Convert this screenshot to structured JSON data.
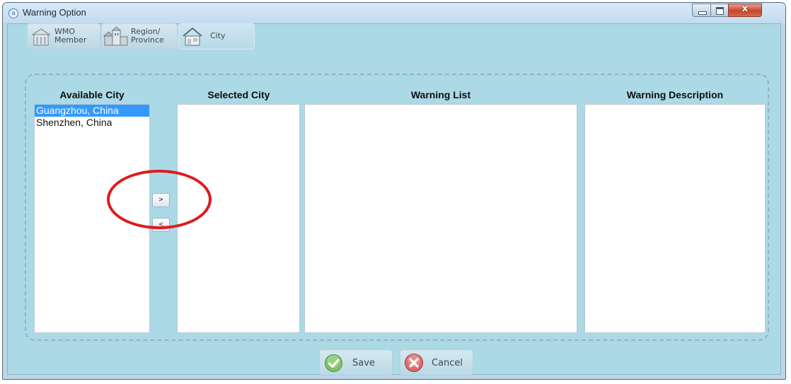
{
  "window": {
    "title": "Warning Option",
    "close_glyph": "x"
  },
  "tabs": [
    {
      "label_line1": "WMO",
      "label_line2": "Member",
      "icon": "member-building-icon"
    },
    {
      "label_line1": "Region/",
      "label_line2": "Province",
      "icon": "region-buildings-icon"
    },
    {
      "label_line1": "City",
      "label_line2": "",
      "icon": "city-house-icon"
    }
  ],
  "columns": {
    "available": {
      "header": "Available City",
      "items": [
        "Guangzhou, China",
        "Shenzhen, China"
      ],
      "selected_index": 0
    },
    "selected": {
      "header": "Selected City",
      "items": []
    },
    "warning_list": {
      "header": "Warning List",
      "items": []
    },
    "warning_description": {
      "header": "Warning Description",
      "items": []
    }
  },
  "move_buttons": {
    "add": ">",
    "remove": "<"
  },
  "actions": {
    "save": "Save",
    "cancel": "Cancel"
  },
  "colors": {
    "selection": "#3399ff",
    "client_bg": "#acd9e6",
    "annotation": "#e01a1a"
  }
}
